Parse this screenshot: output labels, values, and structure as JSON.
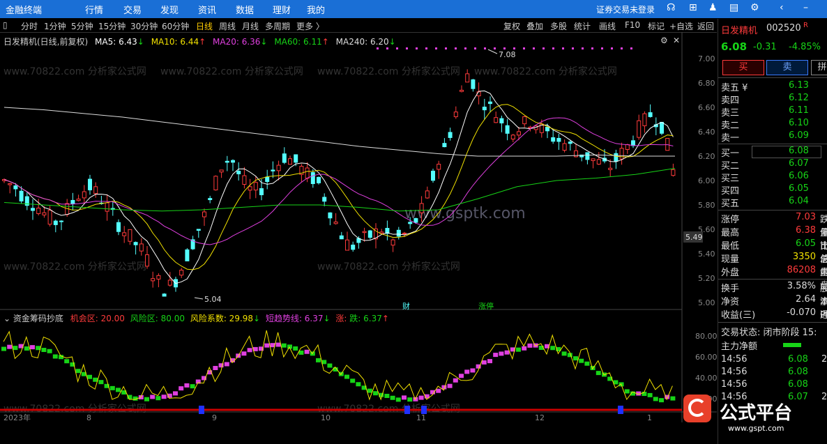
{
  "app": {
    "title": "金融终端",
    "menu": [
      "行情",
      "交易",
      "发现",
      "资讯",
      "数据",
      "理财",
      "我的"
    ],
    "status": "证券交易未登录"
  },
  "periods": [
    "分时",
    "1分钟",
    "5分钟",
    "15分钟",
    "30分钟",
    "60分钟",
    "日线",
    "周线",
    "月线",
    "多周期",
    "更多 〉"
  ],
  "active_period": "日线",
  "toolbar": [
    "复权",
    "叠加",
    "多股",
    "统计",
    "画线",
    "F10",
    "标记",
    "+自选",
    "返回"
  ],
  "chart_header": {
    "name": "日发精机(日线,前复权)",
    "ma5": "MA5: 6.43",
    "ma10": "MA10: 6.44",
    "ma20": "MA20: 6.36",
    "ma60": "MA60: 6.11",
    "ma240": "MA240: 6.20"
  },
  "watermark": "www.70822.com 分析家公式网",
  "watermark2": "www.gsptk.com",
  "price_axis": [
    "7.00",
    "6.80",
    "6.60",
    "6.40",
    "6.20",
    "6.00",
    "5.80",
    "5.60",
    "5.40",
    "5.20",
    "5.00"
  ],
  "price_marker": "5.49",
  "annotations": {
    "high": "7.08",
    "low": "5.04",
    "fin": "财",
    "limit": "涨停"
  },
  "indicator_header": {
    "name": "资金筹码抄底",
    "chance": "机会区: 20.00",
    "risk": "风险区: 80.00",
    "coef": "风险系数: 29.98",
    "trend": "短趋势线: 6.37",
    "up": "涨:",
    "down": "跌: 6.37"
  },
  "indicator_axis": [
    "80.00",
    "60.00",
    "40.00",
    "20.00"
  ],
  "date_axis": [
    "2023年",
    "8",
    "9",
    "10",
    "11",
    "12",
    "1"
  ],
  "stock": {
    "name": "日发精机",
    "code": "002520",
    "r": "R",
    "price": "6.08",
    "change": "-0.31",
    "pct": "-4.85%"
  },
  "buttons": {
    "buy": "买",
    "sell": "卖",
    "other": "拼"
  },
  "asks": [
    {
      "label": "卖五 ¥",
      "price": "6.13"
    },
    {
      "label": "卖四",
      "price": "6.12"
    },
    {
      "label": "卖三",
      "price": "6.11"
    },
    {
      "label": "卖二",
      "price": "6.10"
    },
    {
      "label": "卖一",
      "price": "6.09"
    }
  ],
  "bids": [
    {
      "label": "买一",
      "price": "6.08"
    },
    {
      "label": "买二",
      "price": "6.07"
    },
    {
      "label": "买三",
      "price": "6.06"
    },
    {
      "label": "买四",
      "price": "6.05"
    },
    {
      "label": "买五",
      "price": "6.04"
    }
  ],
  "stats": [
    {
      "k": "涨停",
      "v": "7.03",
      "k2": "跌停"
    },
    {
      "k": "最高",
      "v": "6.38",
      "k2": "量比"
    },
    {
      "k": "最低",
      "v": "6.05",
      "k2": "市值"
    },
    {
      "k": "现量",
      "v": "3350",
      "k2": "总量"
    },
    {
      "k": "外盘",
      "v": "86208",
      "k2": "内盘"
    }
  ],
  "stats2": [
    {
      "k": "换手",
      "v": "3.58%",
      "k2": "股本"
    },
    {
      "k": "净资",
      "v": "2.64",
      "k2": "流通"
    },
    {
      "k": "收益(三)",
      "v": "-0.070",
      "k2": "PE(动"
    }
  ],
  "trade_status": "交易状态: 闭市阶段 15:",
  "net_flow": "主力净额",
  "ticks": [
    {
      "t": "14:56",
      "p": "6.08",
      "v": "2"
    },
    {
      "t": "14:56",
      "p": "6.08",
      "v": ""
    },
    {
      "t": "14:56",
      "p": "6.08",
      "v": ""
    },
    {
      "t": "14:56",
      "p": "6.07",
      "v": "2"
    }
  ],
  "logo": "公式平台",
  "logo_sub": "www.gspt.com",
  "colors": {
    "up": "#ff3b3b",
    "down": "#54ffff",
    "ma5": "#ffffff",
    "ma10": "#f0e000",
    "ma20": "#e040e0",
    "ma60": "#17d417",
    "ma240": "#dddddd",
    "accent": "#1a6fd6"
  }
}
